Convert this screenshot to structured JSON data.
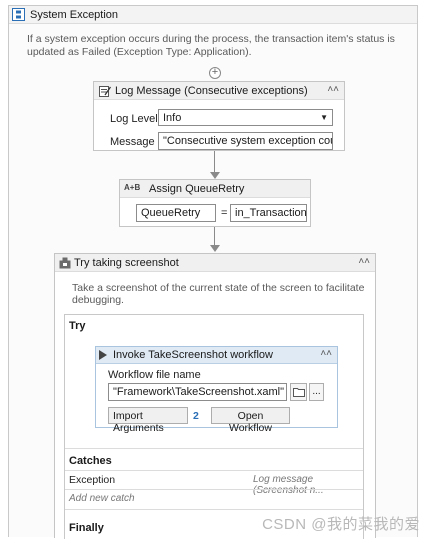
{
  "outer": {
    "title": "System Exception",
    "description": "If a system exception occurs during the process, the transaction item's status is updated as Failed (Exception Type: Application)."
  },
  "log_message": {
    "title": "Log Message (Consecutive exceptions)",
    "level_label": "Log Level",
    "level_value": "Info",
    "message_label": "Message",
    "message_value": "\"Consecutive system exception counter is \""
  },
  "assign": {
    "title": "Assign QueueRetry",
    "to": "QueueRetry",
    "equals": "=",
    "value": "in_TransactionItem"
  },
  "try_screenshot": {
    "title": "Try taking screenshot",
    "description": "Take a screenshot of the current state of the screen to facilitate debugging.",
    "try_label": "Try",
    "catches_label": "Catches",
    "catch_exception": "Exception",
    "catch_action": "Log message (Screenshot n...",
    "add_catch": "Add new catch",
    "finally_label": "Finally"
  },
  "invoke": {
    "title": "Invoke TakeScreenshot workflow",
    "file_label": "Workflow file name",
    "file_value": "\"Framework\\TakeScreenshot.xaml\"",
    "browse_label": "...",
    "import_label": "Import Arguments",
    "import_count": "2",
    "open_label": "Open Workflow"
  },
  "watermark": "CSDN @我的菜我的爱",
  "colors": {
    "invoke_header": "#dfeaf5",
    "accent_blue": "#2a6fb5"
  }
}
